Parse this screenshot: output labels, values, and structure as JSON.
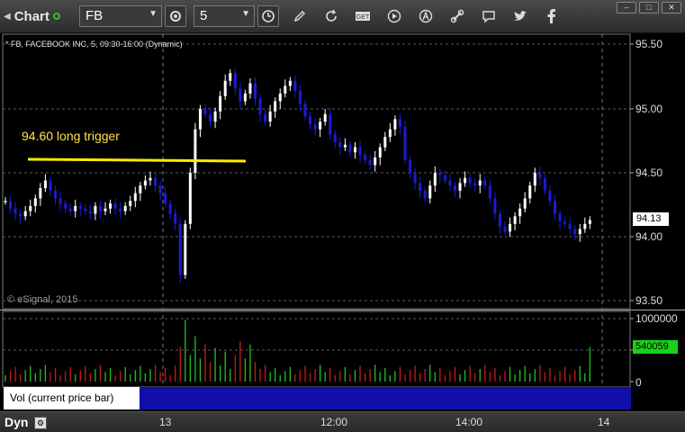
{
  "toolbar": {
    "app_title": "Chart",
    "symbol": "FB",
    "interval": "5",
    "icons": [
      "settings-icon",
      "clock-icon",
      "pencil-icon",
      "refresh-icon",
      "get-icon",
      "play-icon",
      "alert-icon",
      "link-icon",
      "comment-icon",
      "twitter-icon",
      "facebook-icon"
    ],
    "window_buttons": [
      "minimize",
      "maximize",
      "close"
    ]
  },
  "chart": {
    "title": "* FB, FACEBOOK INC, 5, 09:30-16:00 (Dynamic)",
    "annotation": "94.60 long trigger",
    "copyright": "© eSignal, 2015",
    "price_axis": [
      "95.50",
      "95.00",
      "94.50",
      "94.00",
      "93.50"
    ],
    "current_price": "94.13",
    "colors": {
      "up": "#ffffff",
      "down": "#1c1cd6",
      "trigger_line": "#ffea00",
      "vol_up": "#21c121",
      "vol_down": "#c41c1c"
    }
  },
  "volume": {
    "axis": [
      "1000000",
      "0"
    ],
    "current": "540059",
    "study_label": "Vol (current price bar)",
    "close_glyph": "×"
  },
  "time_axis": {
    "mode": "Dyn",
    "labels": [
      "13",
      "12:00",
      "14:00",
      "14"
    ]
  }
}
